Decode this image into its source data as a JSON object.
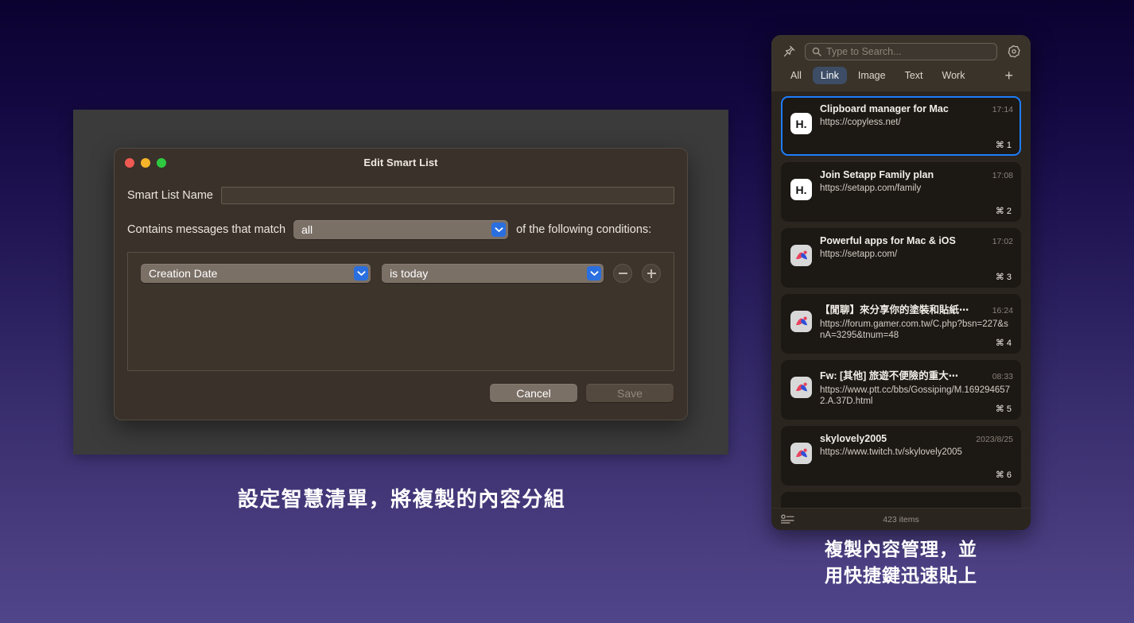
{
  "background": {
    "gradient_top": "#0b0230",
    "gradient_bottom": "#50448a"
  },
  "dialog": {
    "title": "Edit Smart List",
    "traffic_lights": [
      "close",
      "minimize",
      "zoom"
    ],
    "name_label": "Smart List Name",
    "name_value": "",
    "match_prefix_label": "Contains messages that match",
    "match_value": "all",
    "match_suffix_label": "of the following conditions:",
    "conditions": [
      {
        "field": "Creation Date",
        "operator": "is today"
      }
    ],
    "remove_button": "−",
    "add_button": "+",
    "cancel_label": "Cancel",
    "save_label": "Save",
    "accent_blue": "#2a6fe0"
  },
  "clipboard": {
    "search_placeholder": "Type to Search...",
    "tabs": [
      {
        "label": "All",
        "active": false
      },
      {
        "label": "Link",
        "active": true
      },
      {
        "label": "Image",
        "active": false
      },
      {
        "label": "Text",
        "active": false
      },
      {
        "label": "Work",
        "active": false
      }
    ],
    "add_tab_label": "+",
    "selection_color": "#1d7dfc",
    "items": [
      {
        "title": "Clipboard manager for Mac",
        "url": "https://copyless.net/",
        "time": "17:14",
        "shortcut": "⌘ 1",
        "icon": "hey",
        "icon_text": "H.",
        "selected": true
      },
      {
        "title": "Join Setapp Family plan",
        "url": "https://setapp.com/family",
        "time": "17:08",
        "shortcut": "⌘ 2",
        "icon": "hey",
        "icon_text": "H.",
        "selected": false
      },
      {
        "title": "Powerful apps for Mac & iOS",
        "url": "https://setapp.com/",
        "time": "17:02",
        "shortcut": "⌘ 3",
        "icon": "arc",
        "icon_text": "",
        "selected": false
      },
      {
        "title": "【閒聊】來分享你的塗裝和貼紙⋯",
        "url": "https://forum.gamer.com.tw/C.php?bsn=227&snA=3295&tnum=48",
        "time": "16:24",
        "shortcut": "⌘ 4",
        "icon": "arc",
        "icon_text": "",
        "selected": false
      },
      {
        "title": "Fw: [其他] 旅遊不便險的重大⋯",
        "url": "https://www.ptt.cc/bbs/Gossiping/M.1692946572.A.37D.html",
        "time": "08:33",
        "shortcut": "⌘ 5",
        "icon": "arc",
        "icon_text": "",
        "selected": false
      },
      {
        "title": "skylovely2005",
        "url": "https://www.twitch.tv/skylovely2005",
        "time": "2023/8/25",
        "shortcut": "⌘ 6",
        "icon": "arc",
        "icon_text": "",
        "selected": false
      }
    ],
    "footer_count": "423 items"
  },
  "captions": {
    "left": "設定智慧清單，將複製的內容分組",
    "right_line1": "複製內容管理，並",
    "right_line2": "用快捷鍵迅速貼上"
  }
}
